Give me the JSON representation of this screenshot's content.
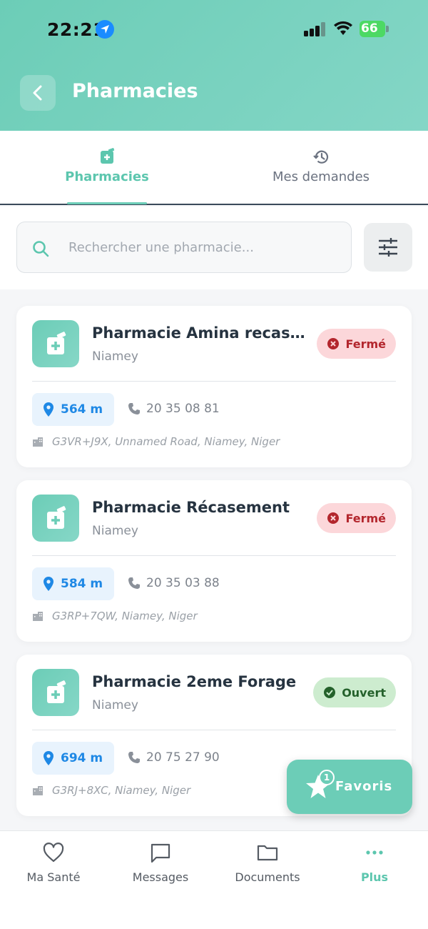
{
  "status_bar": {
    "time": "22:21",
    "battery": "66"
  },
  "header": {
    "title": "Pharmacies"
  },
  "tabs": [
    {
      "label": "Pharmacies",
      "icon": "pharmacy-icon",
      "active": true
    },
    {
      "label": "Mes demandes",
      "icon": "history-icon",
      "active": false
    }
  ],
  "search": {
    "placeholder": "Rechercher une pharmacie..."
  },
  "pharmacies": [
    {
      "name": "Pharmacie Amina recase...",
      "city": "Niamey",
      "status": "Fermé",
      "distance": "564 m",
      "phone": "20 35 08 81",
      "address": "G3VR+J9X, Unnamed Road, Niamey, Niger"
    },
    {
      "name": "Pharmacie Récasement",
      "city": "Niamey",
      "status": "Fermé",
      "distance": "584 m",
      "phone": "20 35 03 88",
      "address": "G3RP+7QW, Niamey, Niger"
    },
    {
      "name": "Pharmacie 2eme Forage",
      "city": "Niamey",
      "status": "Ouvert",
      "distance": "694 m",
      "phone": "20 75 27 90",
      "address": "G3RJ+8XC, Niamey, Niger"
    }
  ],
  "fab": {
    "label": "Favoris",
    "count": "1"
  },
  "bottom_nav": [
    {
      "label": "Ma Santé",
      "icon": "heart-icon"
    },
    {
      "label": "Messages",
      "icon": "message-icon"
    },
    {
      "label": "Documents",
      "icon": "folder-icon"
    },
    {
      "label": "Plus",
      "icon": "more-icon",
      "active": true
    }
  ],
  "colors": {
    "accent": "#6ccdb7",
    "closed": "#b3262d",
    "open": "#24612b",
    "distance": "#1e88e5"
  }
}
